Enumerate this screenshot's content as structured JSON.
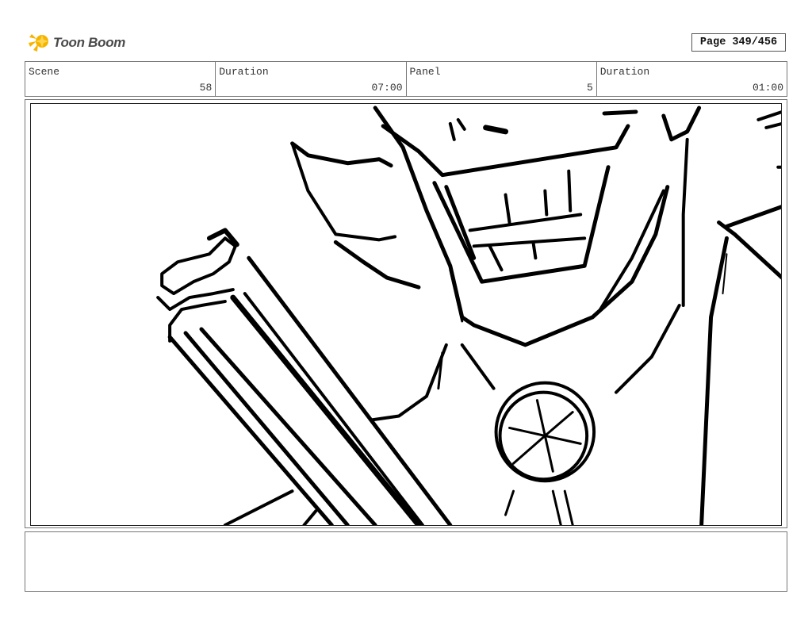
{
  "brand": {
    "name": "Toon Boom",
    "logo_icon": "toon-boom-star-icon",
    "accent_color": "#f5b400"
  },
  "page": {
    "label": "Page 349/456"
  },
  "header": {
    "scene_label": "Scene",
    "scene_value": "58",
    "scene_duration_label": "Duration",
    "scene_duration_value": "07:00",
    "panel_label": "Panel",
    "panel_value": "5",
    "panel_duration_label": "Duration",
    "panel_duration_value": "01:00"
  },
  "panel_image": {
    "description_icon": "storyboard-sketch-icon"
  },
  "notes": {
    "text": ""
  }
}
